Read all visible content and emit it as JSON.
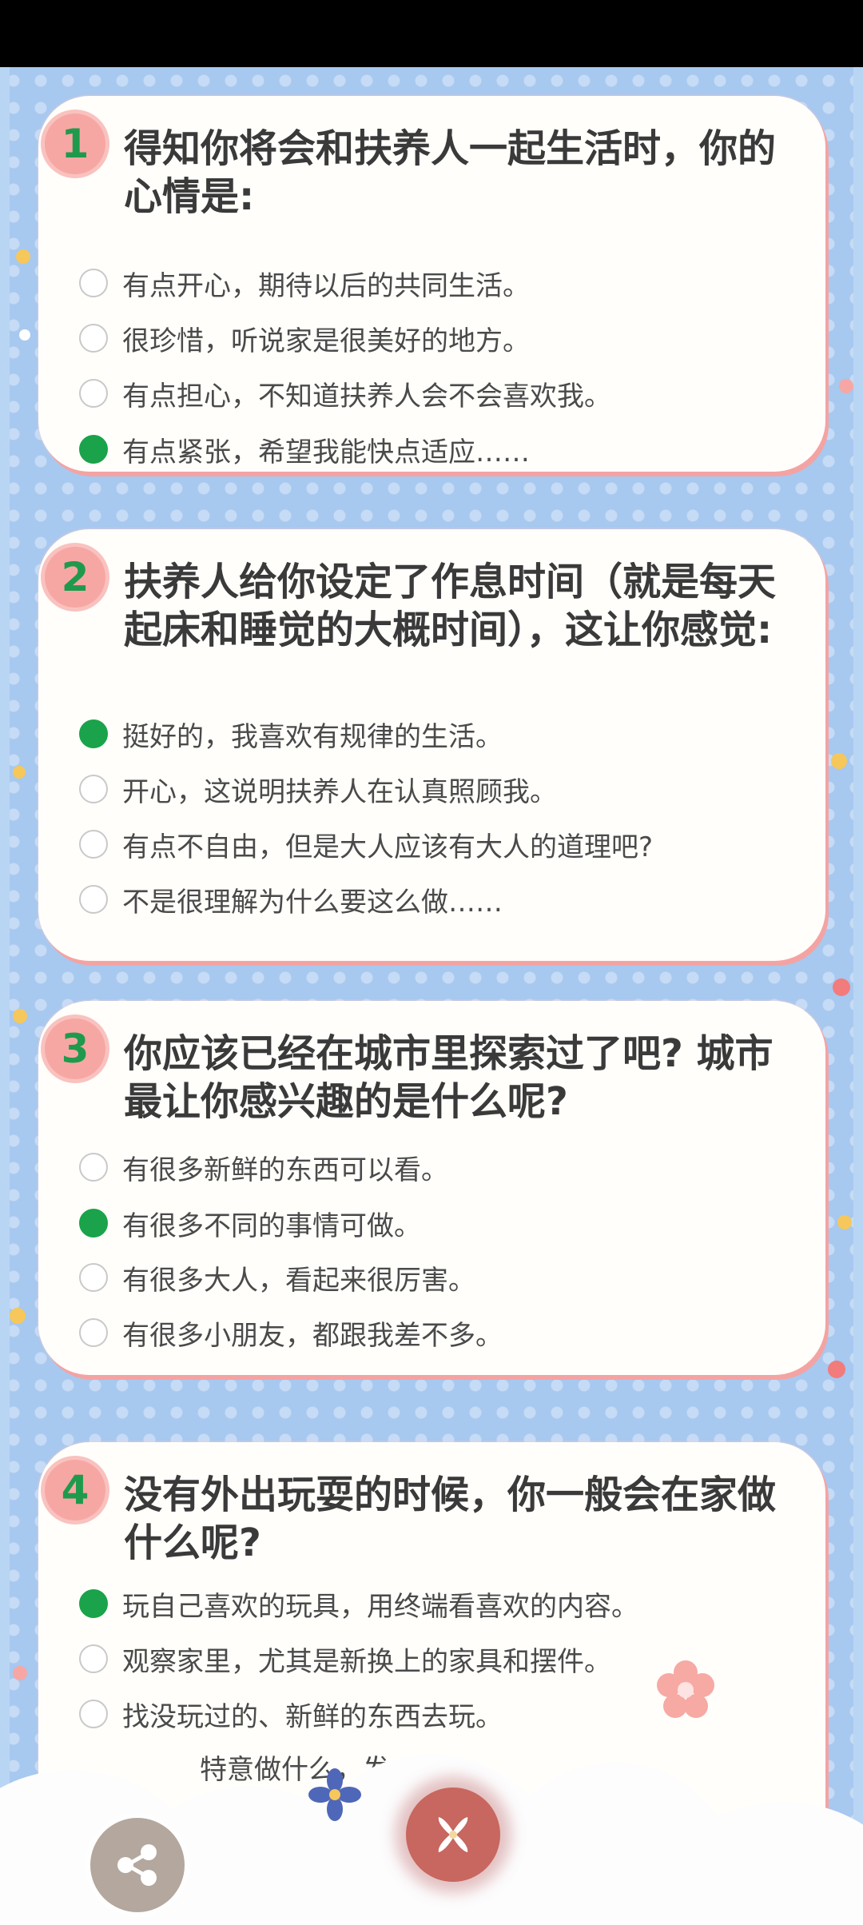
{
  "questions": [
    {
      "number": "1",
      "text": "得知你将会和扶养人一起生活时，你的心情是:",
      "options": [
        {
          "label": "有点开心，期待以后的共同生活。",
          "selected": false
        },
        {
          "label": "很珍惜，听说家是很美好的地方。",
          "selected": false
        },
        {
          "label": "有点担心，不知道扶养人会不会喜欢我。",
          "selected": false
        },
        {
          "label": "有点紧张，希望我能快点适应……",
          "selected": true
        }
      ]
    },
    {
      "number": "2",
      "text": "扶养人给你设定了作息时间（就是每天起床和睡觉的大概时间），这让你感觉:",
      "options": [
        {
          "label": "挺好的，我喜欢有规律的生活。",
          "selected": true
        },
        {
          "label": "开心，这说明扶养人在认真照顾我。",
          "selected": false
        },
        {
          "label": "有点不自由，但是大人应该有大人的道理吧?",
          "selected": false
        },
        {
          "label": "不是很理解为什么要这么做……",
          "selected": false
        }
      ]
    },
    {
      "number": "3",
      "text": "你应该已经在城市里探索过了吧? 城市最让你感兴趣的是什么呢?",
      "options": [
        {
          "label": "有很多新鲜的东西可以看。",
          "selected": false
        },
        {
          "label": "有很多不同的事情可做。",
          "selected": true
        },
        {
          "label": "有很多大人，看起来很厉害。",
          "selected": false
        },
        {
          "label": "有很多小朋友，都跟我差不多。",
          "selected": false
        }
      ]
    },
    {
      "number": "4",
      "text": "没有外出玩耍的时候，你一般会在家做什么呢?",
      "options": [
        {
          "label": "玩自己喜欢的玩具，用终端看喜欢的内容。",
          "selected": true
        },
        {
          "label": "观察家里，尤其是新换上的家具和摆件。",
          "selected": false
        },
        {
          "label": "找没玩过的、新鲜的东西去玩。",
          "selected": false
        },
        {
          "label": "特意做什么，发",
          "selected": false
        }
      ]
    }
  ],
  "controls": {
    "share_icon": "share-icon",
    "close_icon": "close-icon"
  },
  "colors": {
    "selected": "#1aa34a",
    "number": "#1f9a4d",
    "badge": "#f6a7a4",
    "background": "#a7c8ef"
  }
}
